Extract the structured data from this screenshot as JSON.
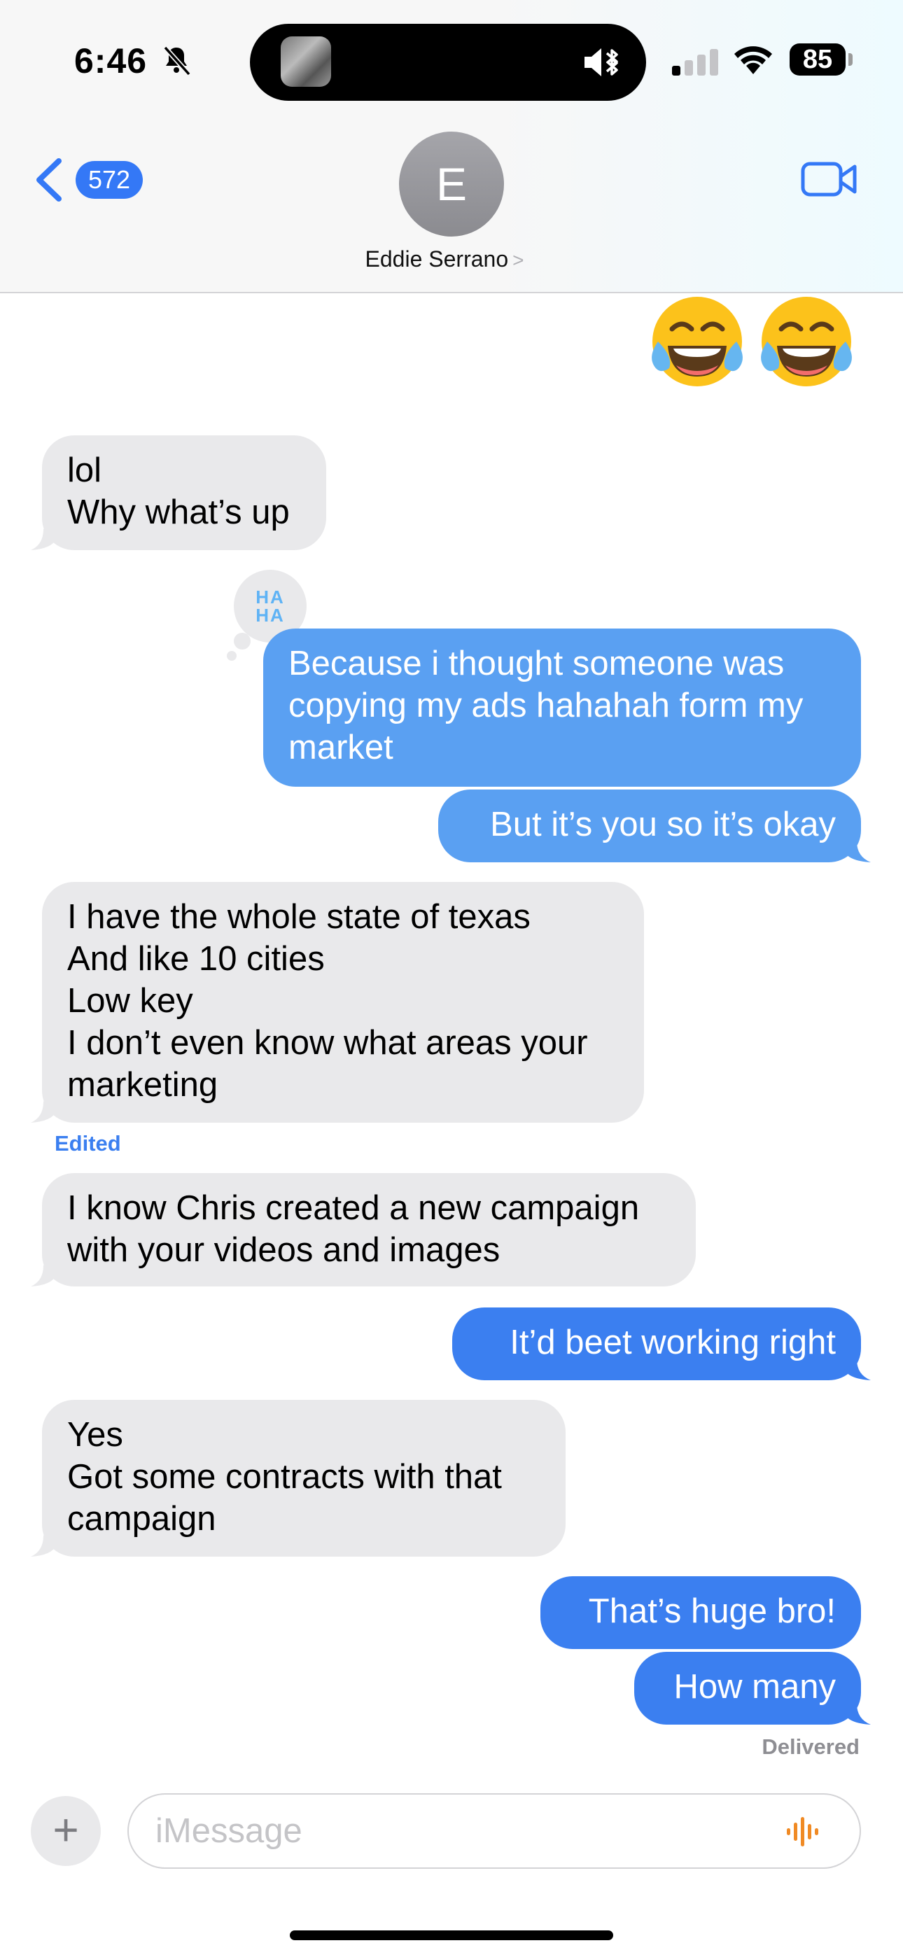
{
  "status_bar": {
    "time": "6:46",
    "battery": "85"
  },
  "header": {
    "back_count": "572",
    "avatar_initial": "E",
    "contact_name": "Eddie Serrano",
    "chevron": ">"
  },
  "messages": [
    {
      "direction": "out",
      "type": "emoji",
      "text": "😂😂"
    },
    {
      "direction": "in",
      "text": "lol\nWhy what’s up"
    },
    {
      "direction": "out",
      "text": "Because i thought someone was copying my ads hahahah form my market",
      "reaction": "HA HA"
    },
    {
      "direction": "out",
      "text": "But it’s you so it’s okay"
    },
    {
      "direction": "in",
      "text": "I have the whole state of texas\nAnd like 10 cities\n Low key\nI don’t even know what areas your marketing",
      "note": "Edited"
    },
    {
      "direction": "in",
      "text": "I know Chris created a new campaign with your videos and images"
    },
    {
      "direction": "out",
      "text": "It’d beet working right"
    },
    {
      "direction": "in",
      "text": "Yes\nGot some contracts with that campaign"
    },
    {
      "direction": "out",
      "text": "That’s huge bro!"
    },
    {
      "direction": "out",
      "text": "How many"
    }
  ],
  "reaction_label": {
    "line1": "HA",
    "line2": "HA"
  },
  "status": "Delivered",
  "composer": {
    "plus": "+",
    "placeholder": "iMessage"
  },
  "colors": {
    "outgoing": "#3b7ff0",
    "incoming": "#e9e9eb",
    "accent": "#3478f6",
    "voice": "#f08a24"
  }
}
